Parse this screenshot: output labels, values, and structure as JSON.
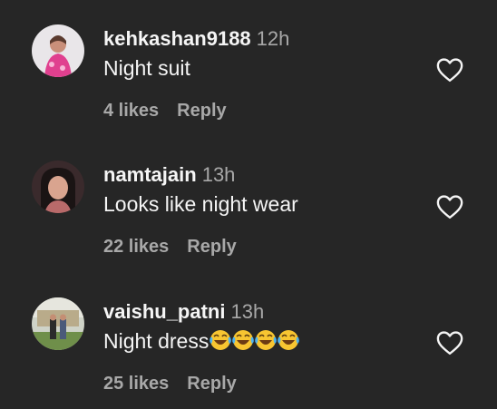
{
  "comments": [
    {
      "username": "kehkashan9188",
      "time": "12h",
      "text": "Night suit",
      "likes": "4 likes",
      "reply": "Reply",
      "avatar_icon": "avatar-photo",
      "like_icon": "heart-outline-icon"
    },
    {
      "username": "namtajain",
      "time": "13h",
      "text": "Looks like night wear",
      "likes": "22 likes",
      "reply": "Reply",
      "avatar_icon": "avatar-photo",
      "like_icon": "heart-outline-icon"
    },
    {
      "username": "vaishu_patni",
      "time": "13h",
      "text": "Night dress",
      "emoji": "😂😂😂😂",
      "likes": "25 likes",
      "reply": "Reply",
      "avatar_icon": "avatar-photo",
      "like_icon": "heart-outline-icon"
    }
  ],
  "colors": {
    "background": "#262626",
    "primary_text": "#f5f5f5",
    "secondary_text": "#a8a8a8"
  }
}
